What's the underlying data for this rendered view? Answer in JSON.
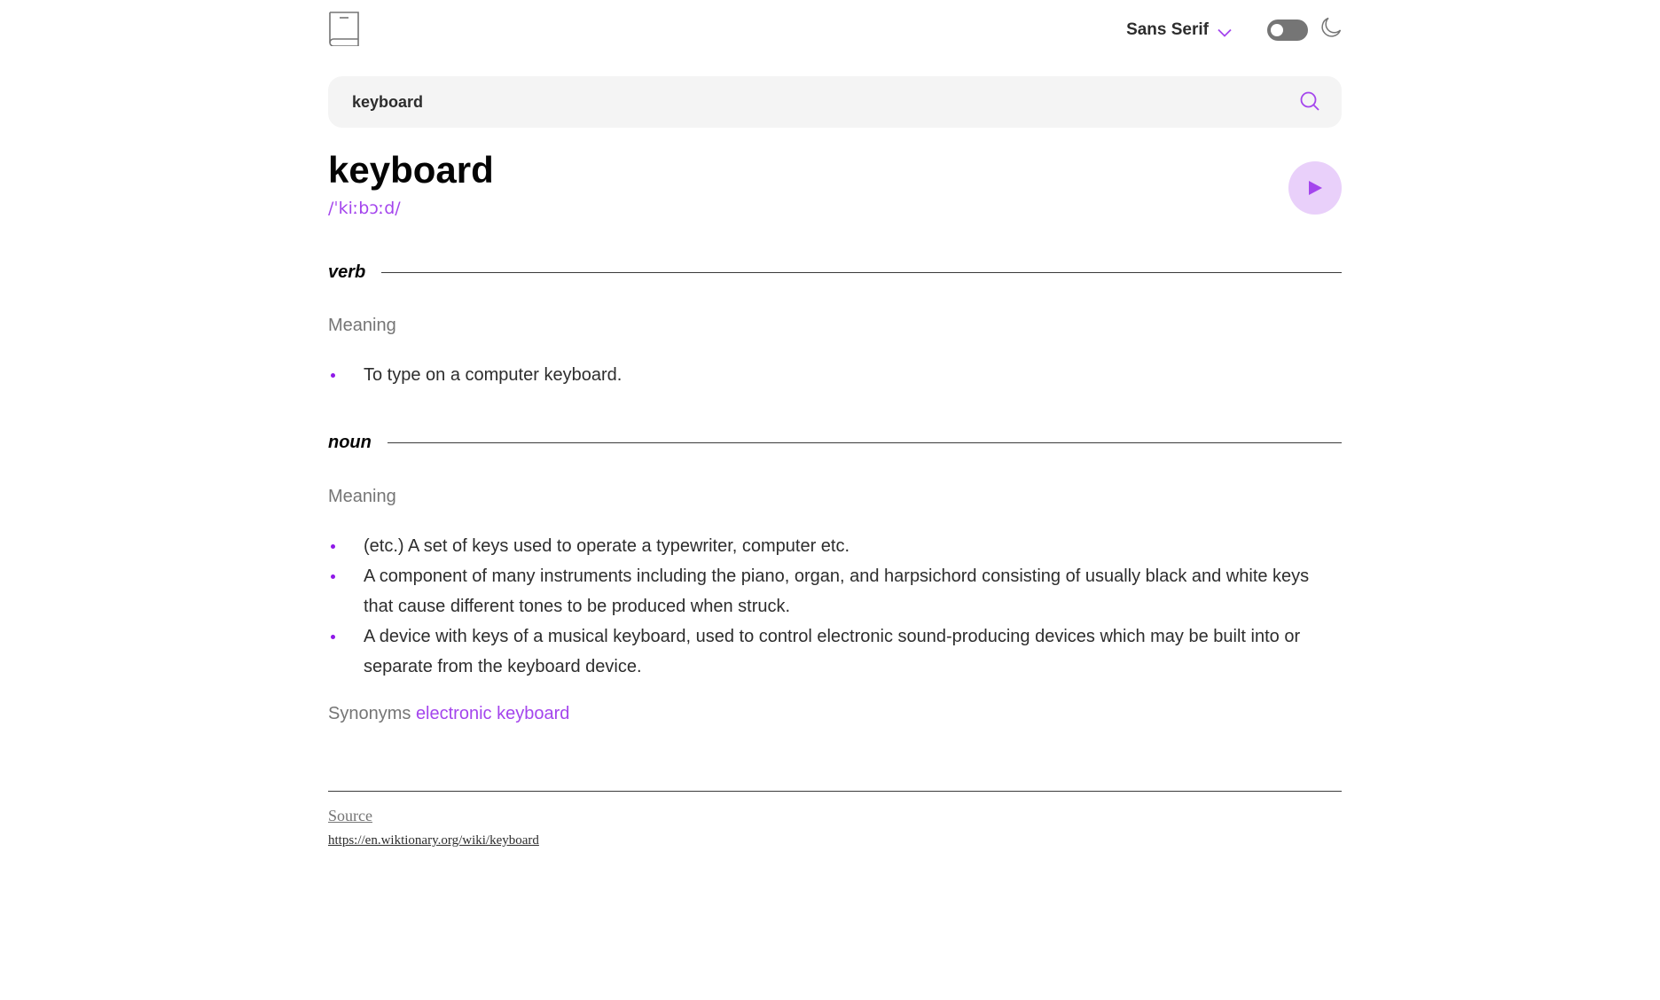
{
  "header": {
    "font_label": "Sans Serif",
    "accent": "#a445ed",
    "icons": [
      "book-icon",
      "chevron-down-icon",
      "toggle-switch",
      "moon-icon"
    ]
  },
  "search": {
    "value": "keyboard",
    "icon": "search-icon"
  },
  "entry": {
    "word": "keyboard",
    "phonetic": "/ˈkiːbɔːd/",
    "play_icon": "play-icon"
  },
  "meanings": [
    {
      "part_of_speech": "verb",
      "meaning_label": "Meaning",
      "definitions": [
        "To type on a computer keyboard."
      ]
    },
    {
      "part_of_speech": "noun",
      "meaning_label": "Meaning",
      "definitions": [
        "(etc.) A set of keys used to operate a typewriter, computer etc.",
        "A component of many instruments including the piano, organ, and harpsichord consisting of usually black and white keys that cause different tones to be produced when struck.",
        "A device with keys of a musical keyboard, used to control electronic sound-producing devices which may be built into or separate from the keyboard device."
      ],
      "synonyms_label": "Synonyms",
      "synonyms": [
        "electronic keyboard"
      ]
    }
  ],
  "footer": {
    "source_label": "Source",
    "source_url": "https://en.wiktionary.org/wiki/keyboard"
  }
}
